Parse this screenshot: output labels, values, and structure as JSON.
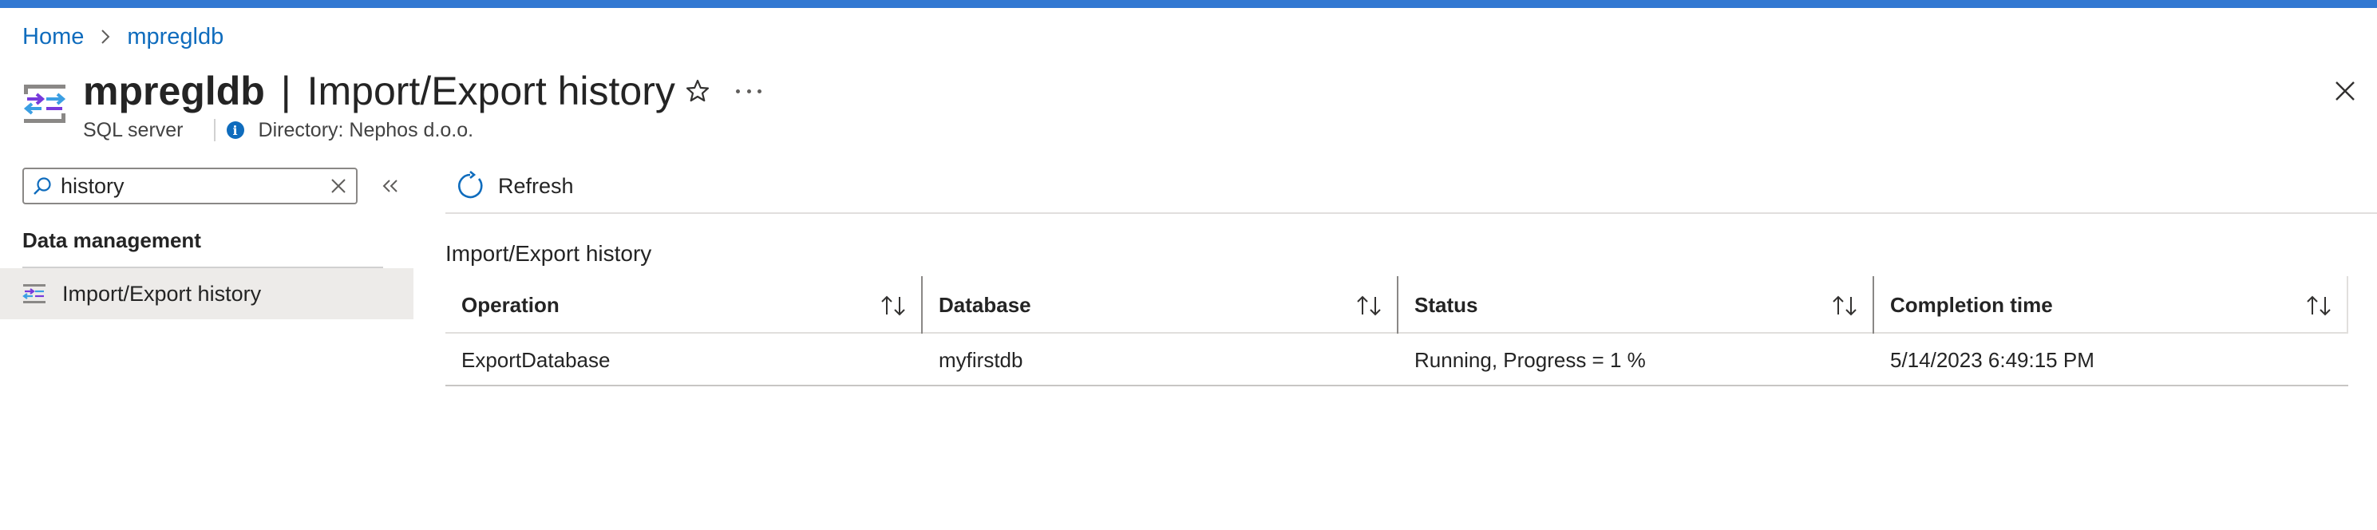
{
  "breadcrumb": {
    "home": "Home",
    "resource": "mpregldb"
  },
  "header": {
    "resource_name": "mpregldb",
    "separator": "|",
    "page_title": "Import/Export history",
    "resource_type": "SQL server",
    "directory": "Directory: Nephos d.o.o."
  },
  "sidebar": {
    "search": {
      "value": "history",
      "placeholder": "Search"
    },
    "group_label": "Data management",
    "items": [
      {
        "label": "Import/Export history",
        "icon": "import-export-icon",
        "selected": true
      }
    ]
  },
  "toolbar": {
    "refresh_label": "Refresh"
  },
  "main": {
    "section_title": "Import/Export history",
    "columns": [
      "Operation",
      "Database",
      "Status",
      "Completion time"
    ],
    "rows": [
      {
        "operation": "ExportDatabase",
        "database": "myfirstdb",
        "status": "Running, Progress = 1 %",
        "completion_time": "5/14/2023 6:49:15 PM"
      }
    ]
  },
  "colors": {
    "accent_bar": "#3278d2",
    "link": "#0f6cbd",
    "selected_nav": "#edebe9"
  }
}
